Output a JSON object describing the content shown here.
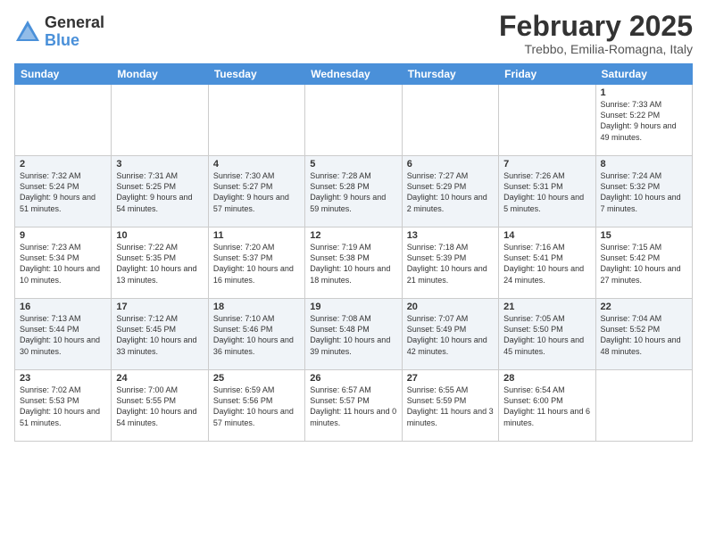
{
  "header": {
    "logo_general": "General",
    "logo_blue": "Blue",
    "month_title": "February 2025",
    "location": "Trebbo, Emilia-Romagna, Italy"
  },
  "weekdays": [
    "Sunday",
    "Monday",
    "Tuesday",
    "Wednesday",
    "Thursday",
    "Friday",
    "Saturday"
  ],
  "weeks": [
    [
      {
        "day": "",
        "info": ""
      },
      {
        "day": "",
        "info": ""
      },
      {
        "day": "",
        "info": ""
      },
      {
        "day": "",
        "info": ""
      },
      {
        "day": "",
        "info": ""
      },
      {
        "day": "",
        "info": ""
      },
      {
        "day": "1",
        "info": "Sunrise: 7:33 AM\nSunset: 5:22 PM\nDaylight: 9 hours\nand 49 minutes."
      }
    ],
    [
      {
        "day": "2",
        "info": "Sunrise: 7:32 AM\nSunset: 5:24 PM\nDaylight: 9 hours\nand 51 minutes."
      },
      {
        "day": "3",
        "info": "Sunrise: 7:31 AM\nSunset: 5:25 PM\nDaylight: 9 hours\nand 54 minutes."
      },
      {
        "day": "4",
        "info": "Sunrise: 7:30 AM\nSunset: 5:27 PM\nDaylight: 9 hours\nand 57 minutes."
      },
      {
        "day": "5",
        "info": "Sunrise: 7:28 AM\nSunset: 5:28 PM\nDaylight: 9 hours\nand 59 minutes."
      },
      {
        "day": "6",
        "info": "Sunrise: 7:27 AM\nSunset: 5:29 PM\nDaylight: 10 hours\nand 2 minutes."
      },
      {
        "day": "7",
        "info": "Sunrise: 7:26 AM\nSunset: 5:31 PM\nDaylight: 10 hours\nand 5 minutes."
      },
      {
        "day": "8",
        "info": "Sunrise: 7:24 AM\nSunset: 5:32 PM\nDaylight: 10 hours\nand 7 minutes."
      }
    ],
    [
      {
        "day": "9",
        "info": "Sunrise: 7:23 AM\nSunset: 5:34 PM\nDaylight: 10 hours\nand 10 minutes."
      },
      {
        "day": "10",
        "info": "Sunrise: 7:22 AM\nSunset: 5:35 PM\nDaylight: 10 hours\nand 13 minutes."
      },
      {
        "day": "11",
        "info": "Sunrise: 7:20 AM\nSunset: 5:37 PM\nDaylight: 10 hours\nand 16 minutes."
      },
      {
        "day": "12",
        "info": "Sunrise: 7:19 AM\nSunset: 5:38 PM\nDaylight: 10 hours\nand 18 minutes."
      },
      {
        "day": "13",
        "info": "Sunrise: 7:18 AM\nSunset: 5:39 PM\nDaylight: 10 hours\nand 21 minutes."
      },
      {
        "day": "14",
        "info": "Sunrise: 7:16 AM\nSunset: 5:41 PM\nDaylight: 10 hours\nand 24 minutes."
      },
      {
        "day": "15",
        "info": "Sunrise: 7:15 AM\nSunset: 5:42 PM\nDaylight: 10 hours\nand 27 minutes."
      }
    ],
    [
      {
        "day": "16",
        "info": "Sunrise: 7:13 AM\nSunset: 5:44 PM\nDaylight: 10 hours\nand 30 minutes."
      },
      {
        "day": "17",
        "info": "Sunrise: 7:12 AM\nSunset: 5:45 PM\nDaylight: 10 hours\nand 33 minutes."
      },
      {
        "day": "18",
        "info": "Sunrise: 7:10 AM\nSunset: 5:46 PM\nDaylight: 10 hours\nand 36 minutes."
      },
      {
        "day": "19",
        "info": "Sunrise: 7:08 AM\nSunset: 5:48 PM\nDaylight: 10 hours\nand 39 minutes."
      },
      {
        "day": "20",
        "info": "Sunrise: 7:07 AM\nSunset: 5:49 PM\nDaylight: 10 hours\nand 42 minutes."
      },
      {
        "day": "21",
        "info": "Sunrise: 7:05 AM\nSunset: 5:50 PM\nDaylight: 10 hours\nand 45 minutes."
      },
      {
        "day": "22",
        "info": "Sunrise: 7:04 AM\nSunset: 5:52 PM\nDaylight: 10 hours\nand 48 minutes."
      }
    ],
    [
      {
        "day": "23",
        "info": "Sunrise: 7:02 AM\nSunset: 5:53 PM\nDaylight: 10 hours\nand 51 minutes."
      },
      {
        "day": "24",
        "info": "Sunrise: 7:00 AM\nSunset: 5:55 PM\nDaylight: 10 hours\nand 54 minutes."
      },
      {
        "day": "25",
        "info": "Sunrise: 6:59 AM\nSunset: 5:56 PM\nDaylight: 10 hours\nand 57 minutes."
      },
      {
        "day": "26",
        "info": "Sunrise: 6:57 AM\nSunset: 5:57 PM\nDaylight: 11 hours\nand 0 minutes."
      },
      {
        "day": "27",
        "info": "Sunrise: 6:55 AM\nSunset: 5:59 PM\nDaylight: 11 hours\nand 3 minutes."
      },
      {
        "day": "28",
        "info": "Sunrise: 6:54 AM\nSunset: 6:00 PM\nDaylight: 11 hours\nand 6 minutes."
      },
      {
        "day": "",
        "info": ""
      }
    ]
  ]
}
